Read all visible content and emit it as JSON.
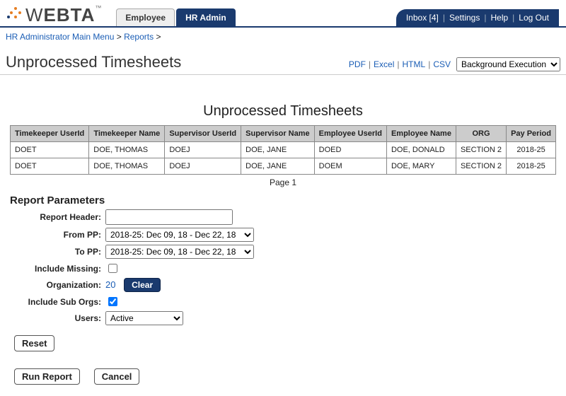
{
  "logo_text": "WEBTA",
  "tabs": {
    "employee": "Employee",
    "hr_admin": "HR Admin"
  },
  "topnav": {
    "inbox": "Inbox [4]",
    "settings": "Settings",
    "help": "Help",
    "logout": "Log Out"
  },
  "breadcrumb": {
    "main": "HR Administrator Main Menu",
    "reports": "Reports"
  },
  "page_title": "Unprocessed Timesheets",
  "export": {
    "pdf": "PDF",
    "excel": "Excel",
    "html": "HTML",
    "csv": "CSV",
    "bg_exec": "Background Execution"
  },
  "report_title": "Unprocessed Timesheets",
  "columns": {
    "tk_uid": "Timekeeper UserId",
    "tk_name": "Timekeeper Name",
    "sup_uid": "Supervisor UserId",
    "sup_name": "Supervisor Name",
    "emp_uid": "Employee UserId",
    "emp_name": "Employee Name",
    "org": "ORG",
    "pp": "Pay Period"
  },
  "rows": [
    {
      "tk_uid": "DOET",
      "tk_name": "DOE, THOMAS",
      "sup_uid": "DOEJ",
      "sup_name": "DOE, JANE",
      "emp_uid": "DOED",
      "emp_name": "DOE, DONALD",
      "org": "SECTION 2",
      "pp": "2018-25"
    },
    {
      "tk_uid": "DOET",
      "tk_name": "DOE, THOMAS",
      "sup_uid": "DOEJ",
      "sup_name": "DOE, JANE",
      "emp_uid": "DOEM",
      "emp_name": "DOE, MARY",
      "org": "SECTION 2",
      "pp": "2018-25"
    }
  ],
  "pager": "Page 1",
  "params": {
    "title": "Report Parameters",
    "header_label": "Report Header:",
    "header_value": "",
    "from_pp_label": "From PP:",
    "to_pp_label": "To PP:",
    "pp_option": "2018-25: Dec 09, 18 - Dec 22, 18",
    "include_missing_label": "Include Missing:",
    "organization_label": "Organization:",
    "organization_value": "20",
    "clear_btn": "Clear",
    "include_sub_label": "Include Sub Orgs:",
    "users_label": "Users:",
    "users_option": "Active"
  },
  "buttons": {
    "reset": "Reset",
    "run": "Run Report",
    "cancel": "Cancel"
  }
}
